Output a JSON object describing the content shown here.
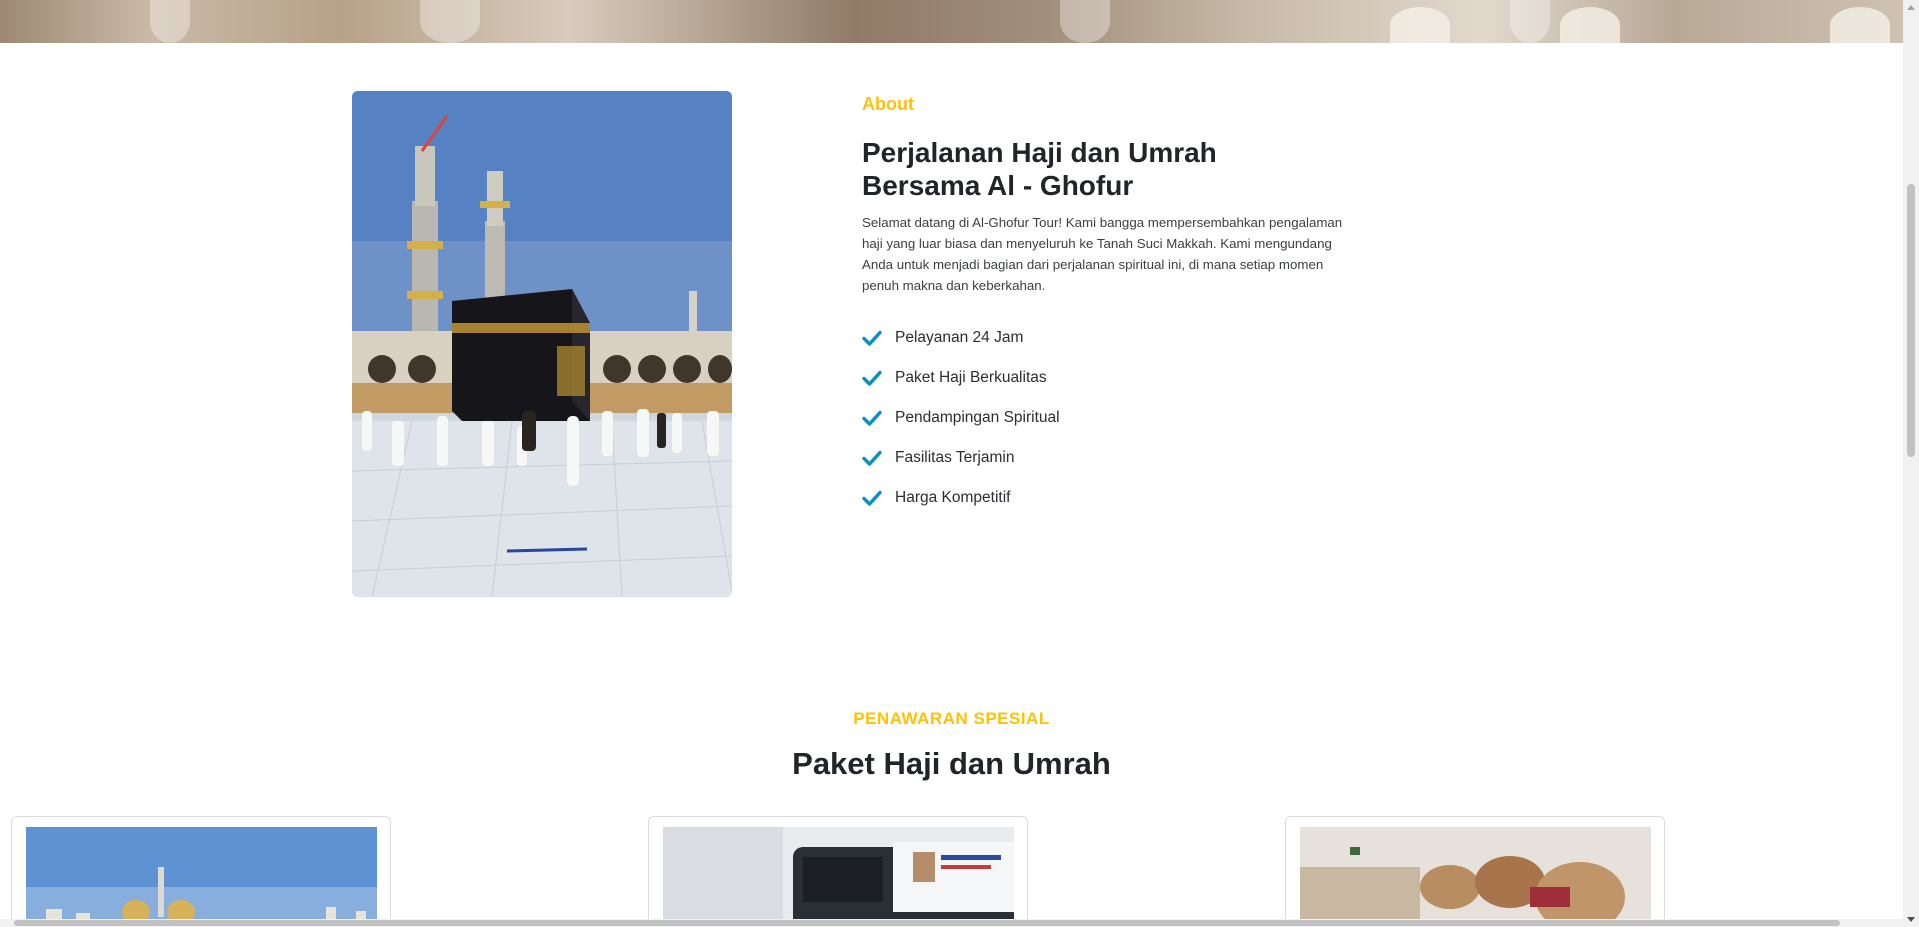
{
  "about": {
    "label": "About",
    "title": "Perjalanan Haji dan Umrah Bersama Al - Ghofur",
    "description": "Selamat datang di Al-Ghofur Tour! Kami bangga mempersembahkan pengalaman haji yang luar biasa dan menyeluruh ke Tanah Suci Makkah. Kami mengundang Anda untuk menjadi bagian dari perjalanan spiritual ini, di mana setiap momen penuh makna dan keberkahan.",
    "features": [
      {
        "label": "Pelayanan 24 Jam",
        "icon": "check-icon"
      },
      {
        "label": "Paket Haji Berkualitas",
        "icon": "check-icon"
      },
      {
        "label": "Pendampingan Spiritual",
        "icon": "check-icon"
      },
      {
        "label": "Fasilitas Terjamin",
        "icon": "check-icon"
      },
      {
        "label": "Harga Kompetitif",
        "icon": "check-icon"
      }
    ]
  },
  "offers": {
    "label": "PENAWARAN SPESIAL",
    "title": "Paket Haji dan Umrah"
  },
  "colors": {
    "accent": "#ffc107",
    "check": "#0d8dc0",
    "heading": "#212529"
  }
}
